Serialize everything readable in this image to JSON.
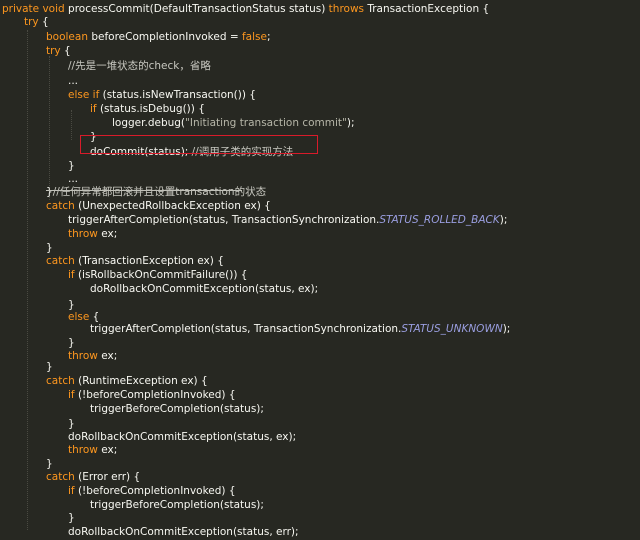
{
  "colors": {
    "background": "#272822",
    "keyword": "#fd971f",
    "text": "#f8f8f2",
    "constant": "#9a9ee0",
    "highlight_border": "#d81b2a"
  },
  "lines": [
    [
      [
        "kw",
        "private void "
      ],
      [
        "fn",
        "processCommit"
      ],
      [
        "plain",
        "(DefaultTransactionStatus status) "
      ],
      [
        "kw",
        "throws "
      ],
      [
        "plain",
        "TransactionException {"
      ]
    ],
    [
      [
        "kw",
        "try "
      ],
      [
        "plain",
        "{"
      ]
    ],
    [
      [
        "kw",
        "boolean "
      ],
      [
        "plain",
        "beforeCompletionInvoked = "
      ],
      [
        "kw",
        "false"
      ],
      [
        "plain",
        ";"
      ]
    ],
    [
      [
        "kw",
        "try "
      ],
      [
        "plain",
        "{"
      ]
    ],
    [
      [
        "cmt",
        "//先是一堆状态的check，省略"
      ]
    ],
    [
      [
        "plain",
        "..."
      ]
    ],
    [
      [
        "kw",
        "else if "
      ],
      [
        "plain",
        "(status.isNewTransaction()) {"
      ]
    ],
    [
      [
        "kw",
        "if "
      ],
      [
        "plain",
        "(status.isDebug()) {"
      ]
    ],
    [
      [
        "plain",
        "logger.debug("
      ],
      [
        "str",
        "\"Initiating transaction commit\""
      ],
      [
        "plain",
        ");"
      ]
    ],
    [
      [
        "plain",
        "}"
      ]
    ],
    [
      [
        "plain",
        "doCommit(status); "
      ],
      [
        "cmt",
        "//调用子类的实现方法"
      ]
    ],
    [
      [
        "plain",
        "}"
      ]
    ],
    [
      [
        "plain",
        "..."
      ]
    ],
    [
      [
        "plain",
        "}"
      ],
      [
        "cmt",
        "//任何异常都回滚并且设置transaction的状态"
      ]
    ],
    [
      [
        "kw",
        "catch "
      ],
      [
        "plain",
        "(UnexpectedRollbackException ex) {"
      ]
    ],
    [
      [
        "plain",
        "triggerAfterCompletion(status, TransactionSynchronization."
      ],
      [
        "const",
        "STATUS_ROLLED_BACK"
      ],
      [
        "plain",
        ");"
      ]
    ],
    [
      [
        "kw",
        "throw "
      ],
      [
        "plain",
        "ex;"
      ]
    ],
    [
      [
        "plain",
        "}"
      ]
    ],
    [
      [
        "kw",
        "catch "
      ],
      [
        "plain",
        "(TransactionException ex) {"
      ]
    ],
    [
      [
        "kw",
        "if "
      ],
      [
        "plain",
        "(isRollbackOnCommitFailure()) {"
      ]
    ],
    [
      [
        "plain",
        "doRollbackOnCommitException(status, ex);"
      ]
    ],
    [
      [
        "plain",
        "}"
      ]
    ],
    [
      [
        "kw",
        "else "
      ],
      [
        "plain",
        "{"
      ]
    ],
    [
      [
        "plain",
        "triggerAfterCompletion(status, TransactionSynchronization."
      ],
      [
        "const",
        "STATUS_UNKNOWN"
      ],
      [
        "plain",
        ");"
      ]
    ],
    [
      [
        "plain",
        "}"
      ]
    ],
    [
      [
        "kw",
        "throw "
      ],
      [
        "plain",
        "ex;"
      ]
    ],
    [
      [
        "plain",
        "}"
      ]
    ],
    [
      [
        "kw",
        "catch "
      ],
      [
        "plain",
        "(RuntimeException ex) {"
      ]
    ],
    [
      [
        "kw",
        "if "
      ],
      [
        "plain",
        "(!beforeCompletionInvoked) {"
      ]
    ],
    [
      [
        "plain",
        "triggerBeforeCompletion(status);"
      ]
    ],
    [
      [
        "plain",
        "}"
      ]
    ],
    [
      [
        "plain",
        "doRollbackOnCommitException(status, ex);"
      ]
    ],
    [
      [
        "kw",
        "throw "
      ],
      [
        "plain",
        "ex;"
      ]
    ],
    [
      [
        "plain",
        "}"
      ]
    ],
    [
      [
        "kw",
        "catch "
      ],
      [
        "plain",
        "(Error err) {"
      ]
    ],
    [
      [
        "kw",
        "if "
      ],
      [
        "plain",
        "(!beforeCompletionInvoked) {"
      ]
    ],
    [
      [
        "plain",
        "triggerBeforeCompletion(status);"
      ]
    ],
    [
      [
        "plain",
        "}"
      ]
    ],
    [
      [
        "plain",
        "doRollbackOnCommitException(status, err);"
      ]
    ]
  ]
}
